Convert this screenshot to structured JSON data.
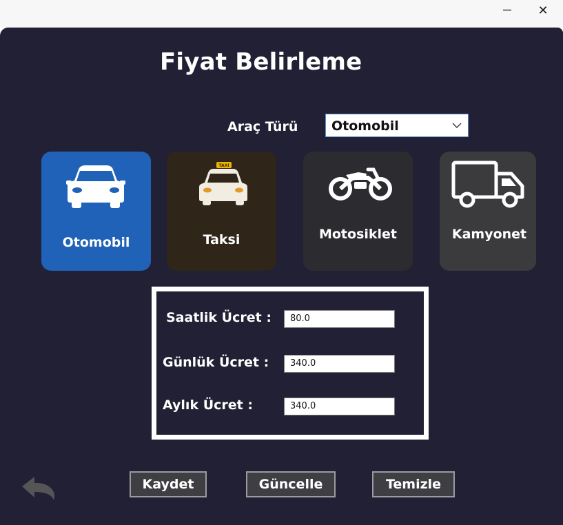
{
  "window": {
    "minimize_glyph": "—",
    "close_glyph": "✕"
  },
  "title": "Fiyat Belirleme",
  "vehicle_type": {
    "label": "Araç Türü",
    "selected": "Otomobil"
  },
  "cards": [
    {
      "label": "Otomobil",
      "icon": "car-icon",
      "selected": true
    },
    {
      "label": "Taksi",
      "icon": "taxi-icon",
      "selected": false
    },
    {
      "label": "Motosiklet",
      "icon": "motorcycle-icon",
      "selected": false
    },
    {
      "label": "Kamyonet",
      "icon": "truck-icon",
      "selected": false
    }
  ],
  "fees": {
    "hourly": {
      "label": "Saatlik Ücret :",
      "value": "80.0"
    },
    "daily": {
      "label": "Günlük Ücret :",
      "value": "340.0"
    },
    "monthly": {
      "label": "Aylık Ücret :",
      "value": "340.0"
    }
  },
  "buttons": {
    "save": "Kaydet",
    "update": "Güncelle",
    "clear": "Temizle"
  },
  "colors": {
    "background": "#212034",
    "selected_card": "#2062b7",
    "taxi_card": "#2f2619",
    "button": "#3f3f43"
  }
}
